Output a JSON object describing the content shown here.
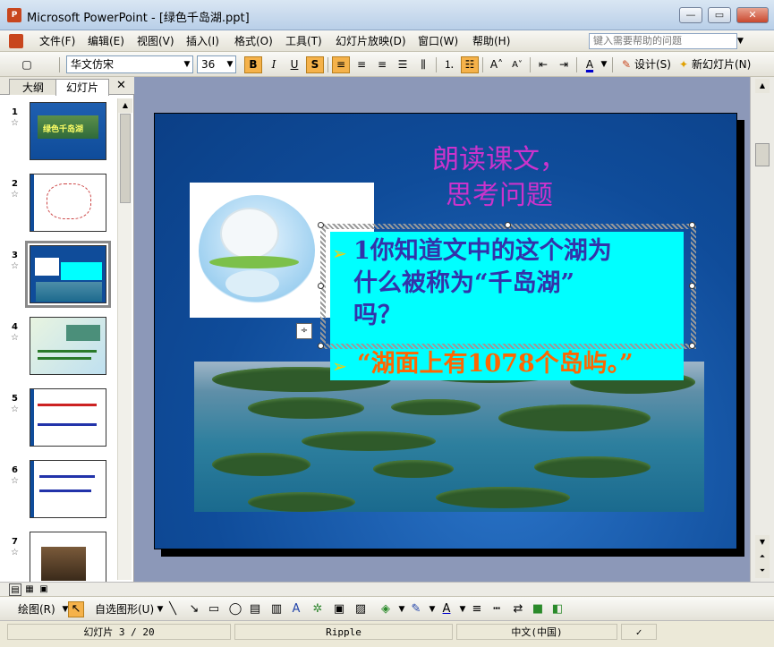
{
  "window": {
    "title": "Microsoft PowerPoint - [绿色千岛湖.ppt]",
    "app_icon": "P"
  },
  "menu": {
    "items": [
      "文件(F)",
      "编辑(E)",
      "视图(V)",
      "插入(I)",
      "格式(O)",
      "工具(T)",
      "幻灯片放映(D)",
      "窗口(W)",
      "帮助(H)"
    ],
    "help_placeholder": "键入需要帮助的问题"
  },
  "toolbar": {
    "font_name": "华文仿宋",
    "font_size": "36",
    "bold": "B",
    "italic": "I",
    "underline": "U",
    "shadow": "S",
    "font_color": "A",
    "design_label": "设计(S)",
    "new_slide_label": "新幻灯片(N)"
  },
  "left_panel": {
    "tabs": [
      "大纲",
      "幻灯片"
    ],
    "close": "✕",
    "thumbnails": [
      {
        "num": "1",
        "caption": "绿色千岛湖"
      },
      {
        "num": "2",
        "caption": ""
      },
      {
        "num": "3",
        "caption": ""
      },
      {
        "num": "4",
        "caption": ""
      },
      {
        "num": "5",
        "caption": ""
      },
      {
        "num": "6",
        "caption": ""
      },
      {
        "num": "7",
        "caption": ""
      }
    ],
    "star": "☆"
  },
  "slide": {
    "title_line1": "朗读课文，",
    "title_line2": "思考问题",
    "bullet1_line1": "1你知道文中的这个湖为",
    "bullet1_line2": "什么被称为“千岛湖”",
    "bullet1_line3": "吗？",
    "bullet2": "“湖面上有1078个岛屿。”",
    "bullet_glyph": "➢"
  },
  "drawing": {
    "draw_label": "绘图(R)",
    "autoshape_label": "自选图形(U)"
  },
  "status": {
    "slide_info": "幻灯片 3 / 20",
    "theme": "Ripple",
    "language": "中文(中国)"
  },
  "colors": {
    "slide_bg": "#0f4c9a",
    "title_color": "#cc33cc",
    "textbox_bg": "#00ffff",
    "bullet1_color": "#3333aa",
    "bullet2_color": "#ff6600",
    "active_button": "#f5b24a"
  }
}
